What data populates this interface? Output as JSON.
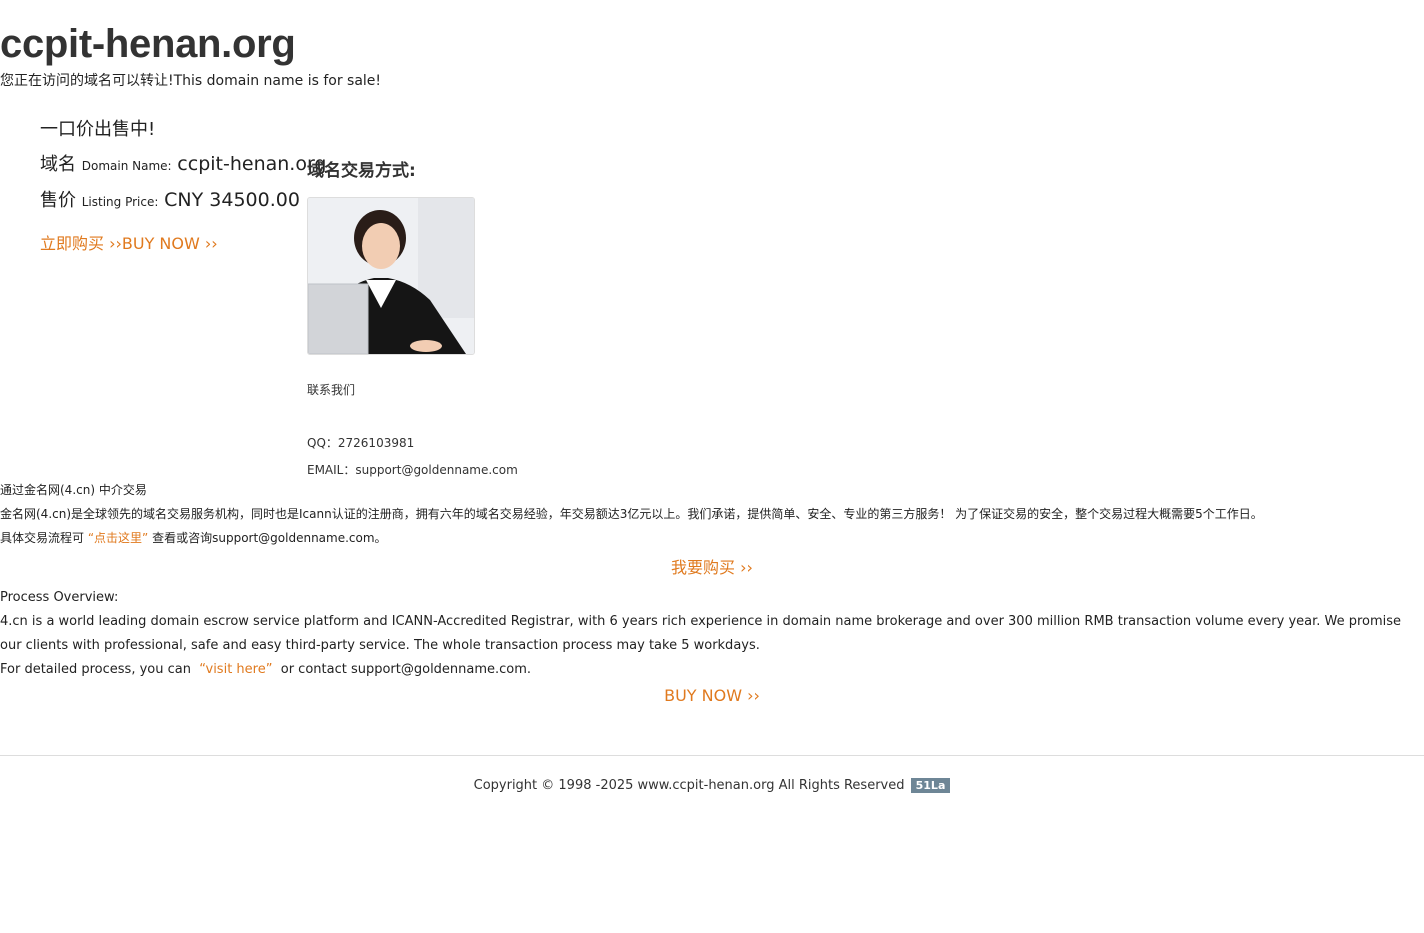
{
  "header": {
    "domain": "ccpit-henan.org",
    "notice": "您正在访问的域名可以转让!This domain name is for sale!"
  },
  "sale": {
    "heading": "一口价出售中!",
    "domain_label_zh": "域名",
    "domain_label_en": "Domain Name:",
    "domain_value": "ccpit-henan.org",
    "price_label_zh": "售价",
    "price_label_en": "Listing Price:",
    "price_value": "CNY 34500.00",
    "buy_label": "立即购买 ››BUY NOW ››"
  },
  "contact": {
    "heading": "域名交易方式:",
    "photo_icon": "agent-photo",
    "contact_us": "联系我们",
    "qq": "QQ：2726103981",
    "email": "EMAIL：support@goldenname.com"
  },
  "zh_info": {
    "via": "通过金名网(4.cn) 中介交易",
    "description": "金名网(4.cn)是全球领先的域名交易服务机构，同时也是Icann认证的注册商，拥有六年的域名交易经验，年交易额达3亿元以上。我们承诺，提供简单、安全、专业的第三方服务！ 为了保证交易的安全，整个交易过程大概需要5个工作日。",
    "process_prefix": "具体交易流程可",
    "process_link": "“点击这里”",
    "process_suffix": "查看或咨询support@goldenname.com。",
    "buy_label": "我要购买 ››"
  },
  "en_info": {
    "heading": "Process Overview:",
    "description": "4.cn is a world leading domain escrow service platform and ICANN-Accredited Registrar, with 6 years rich experience in domain name brokerage and over 300 million RMB transaction volume every year. We promise our clients with professional, safe and easy third-party service. The whole transaction process may take 5 workdays.",
    "process_prefix": "For detailed process, you can",
    "process_link": "“visit here”",
    "process_suffix": "or contact support@goldenname.com.",
    "buy_label": "BUY NOW ››"
  },
  "footer": {
    "copyright": "Copyright © 1998 -2025 www.ccpit-henan.org All Rights Reserved",
    "badge": "51La"
  },
  "colors": {
    "accent": "#e07a1f",
    "badge_bg": "#6e8696"
  }
}
